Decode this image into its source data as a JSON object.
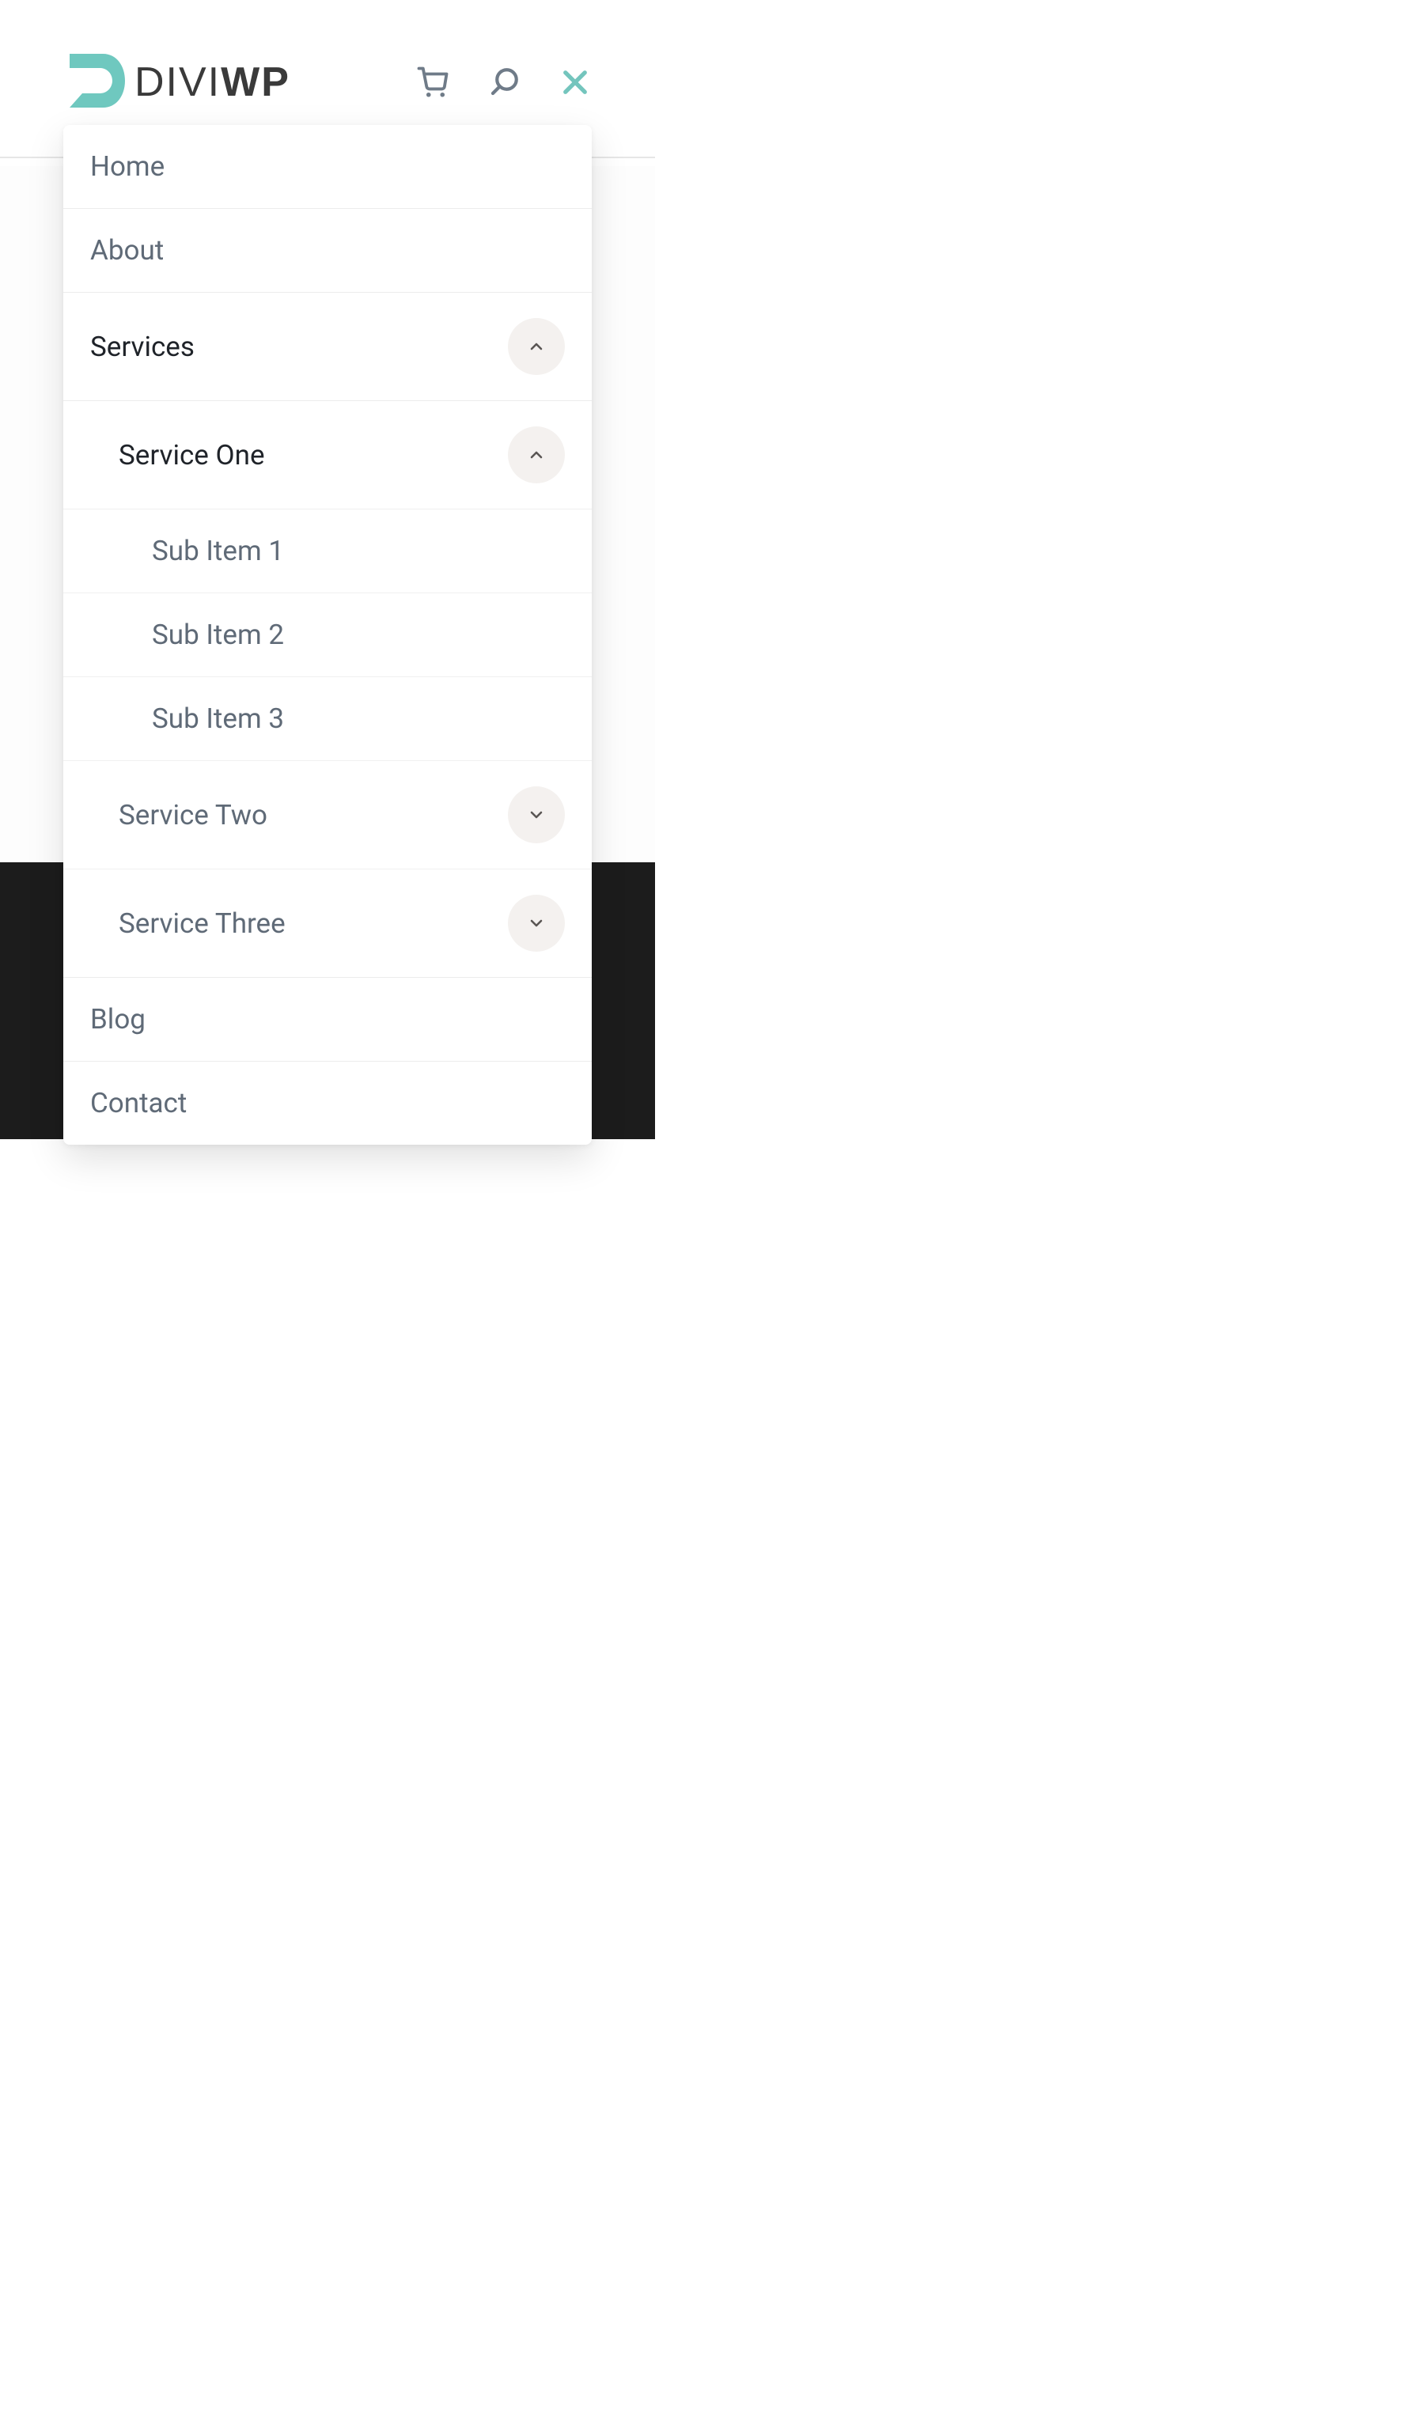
{
  "logo": {
    "text_divi": "DIVI",
    "text_wp": "WP"
  },
  "header_icons": {
    "cart": "cart-icon",
    "search": "search-icon",
    "close": "close-icon"
  },
  "menu": {
    "items": [
      {
        "label": "Home"
      },
      {
        "label": "About"
      },
      {
        "label": "Services",
        "expanded": true
      },
      {
        "label": "Service One",
        "expanded": true
      },
      {
        "label": "Sub Item 1"
      },
      {
        "label": "Sub Item 2"
      },
      {
        "label": "Sub Item 3"
      },
      {
        "label": "Service Two",
        "expanded": false
      },
      {
        "label": "Service Three",
        "expanded": false
      },
      {
        "label": "Blog"
      },
      {
        "label": "Contact"
      }
    ]
  },
  "colors": {
    "accent": "#6fc8bf",
    "text_muted": "#5f6a77",
    "text_active": "#1f2329",
    "dark_band": "#1c1c1c",
    "toggle_bg": "#f4f1ef"
  }
}
